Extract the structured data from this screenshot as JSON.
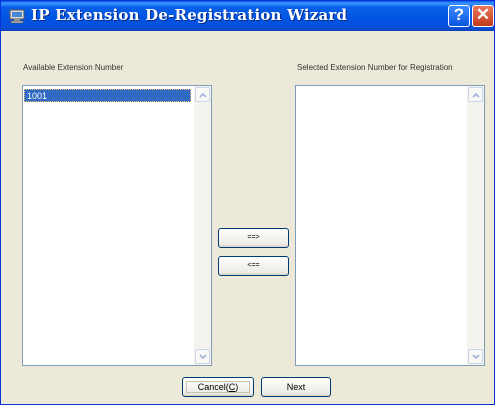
{
  "window": {
    "title": "IP Extension De-Registration Wizard",
    "title_bar_color": "#0054e3"
  },
  "title_buttons": {
    "help": "?",
    "close": "✕"
  },
  "left_panel": {
    "label": "Available Extension Number",
    "items": [
      "1001"
    ],
    "selected_item": "1001"
  },
  "right_panel": {
    "label": "Selected Extension Number for Registration",
    "items": []
  },
  "move_buttons": {
    "add": "==>",
    "remove": "<=="
  },
  "footer": {
    "cancel_prefix": "Cancel(",
    "cancel_accel": "C",
    "cancel_suffix": ")",
    "next": "Next"
  },
  "icons": [
    "window-app-icon",
    "help-icon",
    "close-icon",
    "chevron-up-icon",
    "chevron-down-icon"
  ],
  "colors": {
    "dialog_background": "#ece9d8",
    "selection": "#316ac5",
    "list_border": "#7f9db9"
  }
}
